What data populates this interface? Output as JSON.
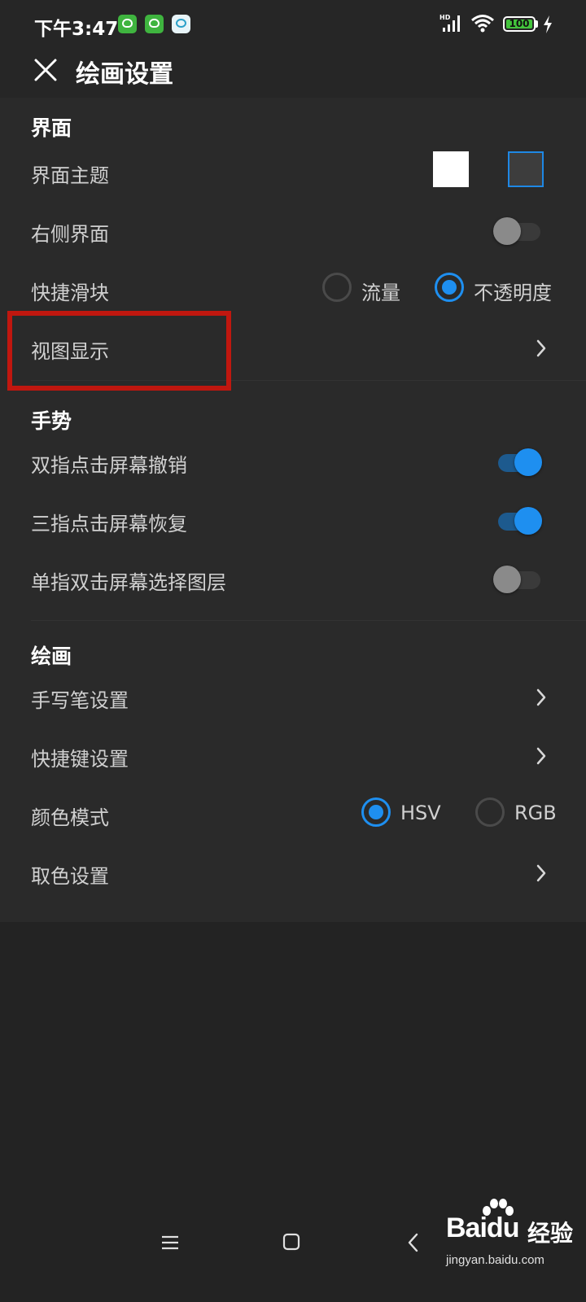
{
  "status_bar": {
    "time": "下午3:47",
    "battery_level": "100",
    "network_badge": "HD"
  },
  "app_bar": {
    "title": "绘画设置"
  },
  "section_interface": {
    "title": "界面",
    "theme_label": "界面主题",
    "right_panel_label": "右侧界面",
    "right_panel_on": false,
    "quick_slider_label": "快捷滑块",
    "quick_slider_options": [
      "流量",
      "不透明度"
    ],
    "quick_slider_selected": "不透明度",
    "view_display_label": "视图显示"
  },
  "section_gesture": {
    "title": "手势",
    "two_finger_label": "双指点击屏幕撤销",
    "two_finger_on": true,
    "three_finger_label": "三指点击屏幕恢复",
    "three_finger_on": true,
    "single_double_label": "单指双击屏幕选择图层",
    "single_double_on": false
  },
  "section_paint": {
    "title": "绘画",
    "stylus_label": "手写笔设置",
    "shortcut_label": "快捷键设置",
    "color_mode_label": "颜色模式",
    "color_mode_options": [
      "HSV",
      "RGB"
    ],
    "color_mode_selected": "HSV",
    "color_pick_label": "取色设置"
  },
  "watermark": {
    "brand_left": "Bai",
    "brand_right": "du",
    "suffix": "经验",
    "url": "jingyan.baidu.com"
  },
  "colors": {
    "accent": "#1e8ff0",
    "highlight": "#c0170f",
    "background": "#232323"
  }
}
